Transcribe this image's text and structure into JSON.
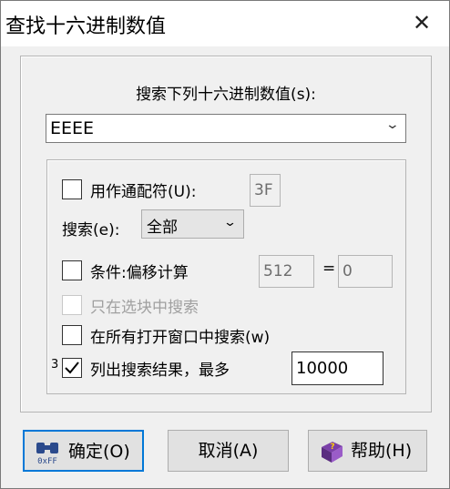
{
  "window": {
    "title": "查找十六进制数值",
    "close_glyph": "✕"
  },
  "prompt": "搜索下列十六进制数值(s):",
  "search_value": "EEEE",
  "options": {
    "wildcard": {
      "label": "用作通配符(U):",
      "checked": false,
      "value": "3F"
    },
    "search_dir": {
      "label": "搜索(e):",
      "selected": "全部"
    },
    "condition": {
      "label": "条件:偏移计算",
      "checked": false,
      "value1": "512",
      "equals": "=",
      "value2": "0"
    },
    "in_block": {
      "label": "只在选块中搜索",
      "checked": false,
      "disabled": true
    },
    "all_windows": {
      "label": "在所有打开窗口中搜索(w)",
      "checked": false
    },
    "list_results": {
      "prefix_digit": "3",
      "label": "列出搜索结果，最多",
      "checked": true,
      "value": "10000"
    }
  },
  "buttons": {
    "ok": {
      "label": "确定(O)",
      "icon_text": "0xFF"
    },
    "cancel": {
      "label": "取消(A)"
    },
    "help": {
      "label": "帮助(H)"
    }
  }
}
